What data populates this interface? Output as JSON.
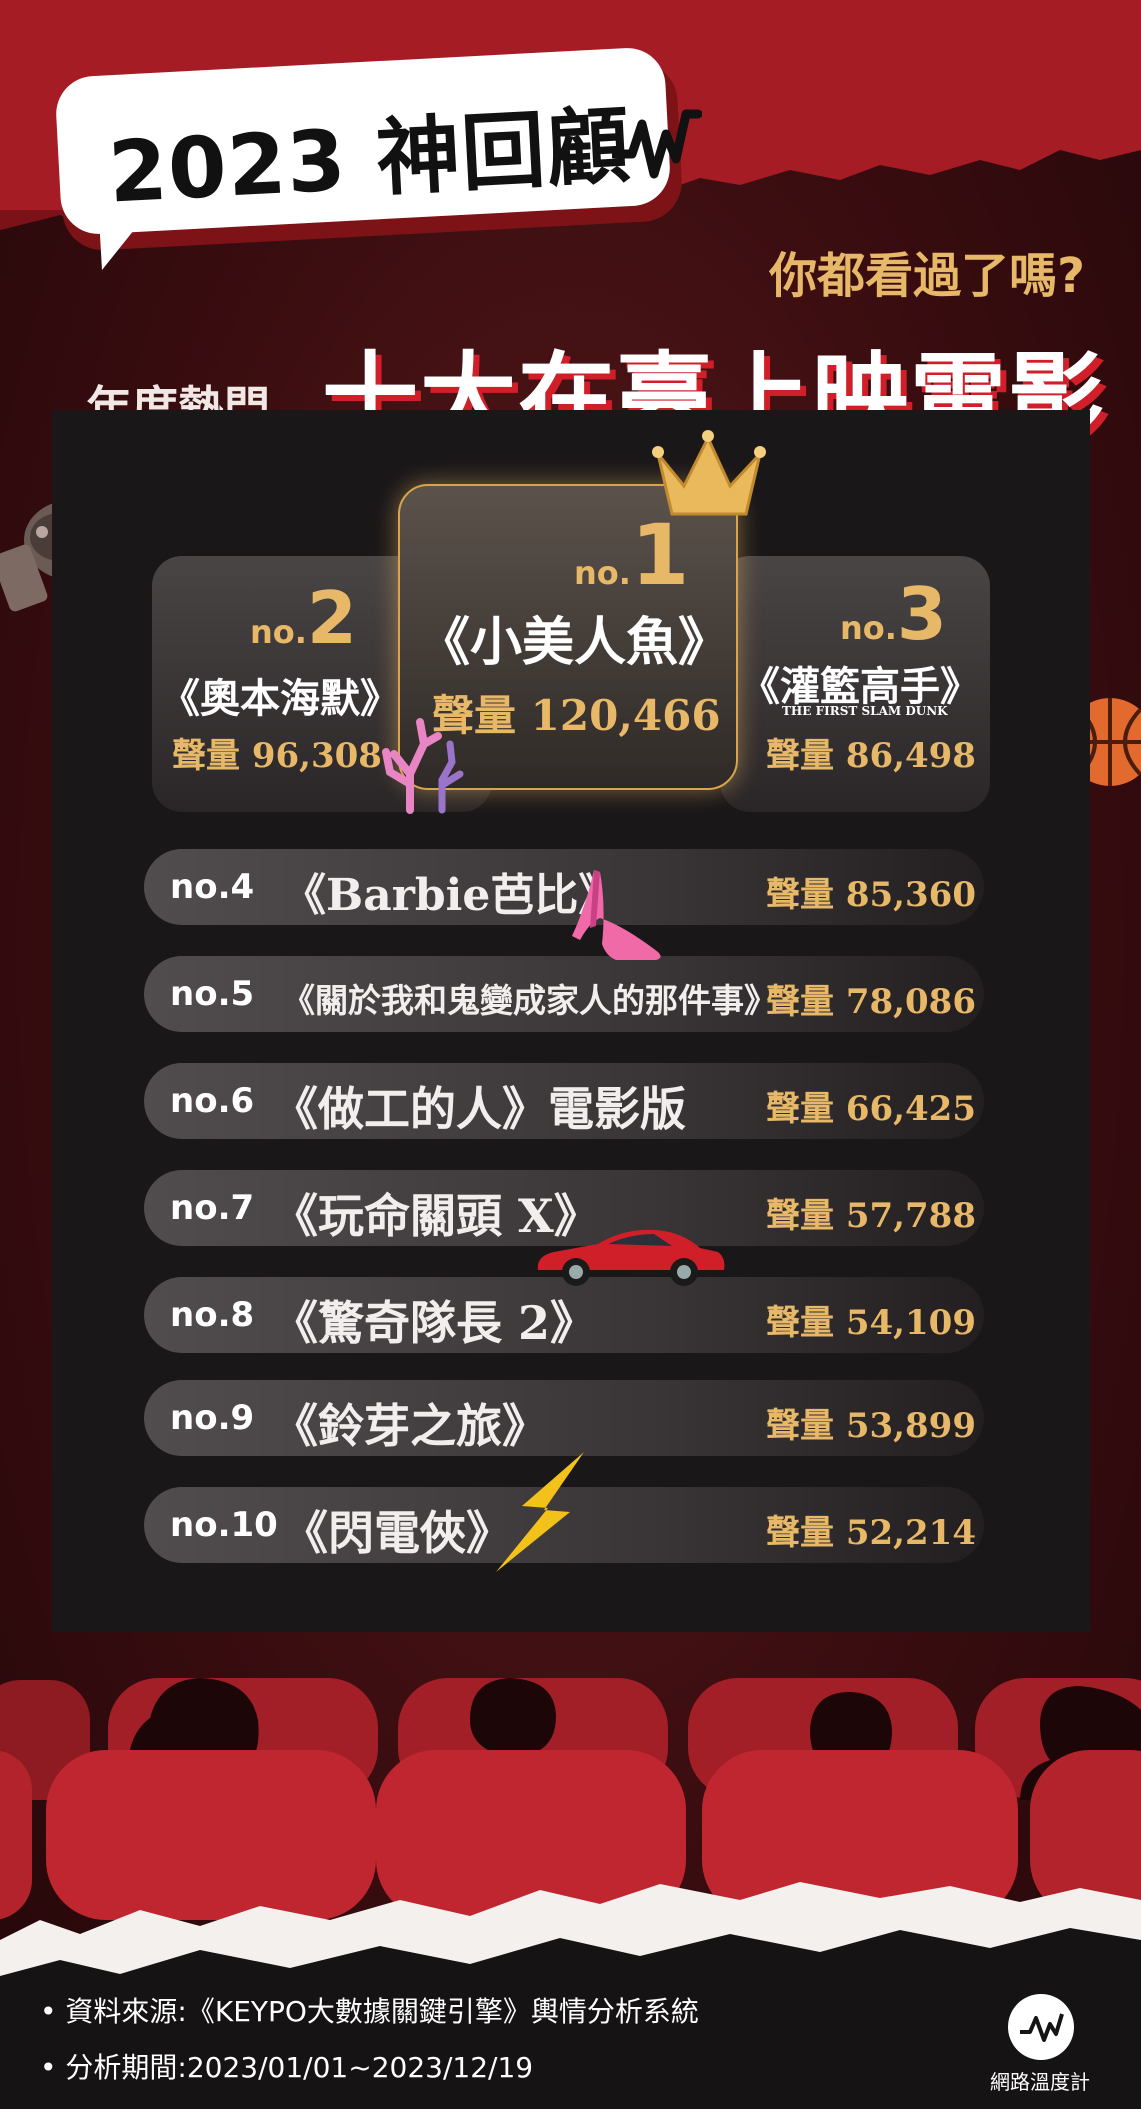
{
  "header": {
    "title": "2023 神回顧",
    "question": "你都看過了嗎?",
    "year_label": "年度熱門",
    "main_title": "十大在臺上映電影"
  },
  "top3": [
    {
      "rank_prefix": "no.",
      "rank": "1",
      "title": "《小美人魚》",
      "volume": "聲量 120,466"
    },
    {
      "rank_prefix": "no.",
      "rank": "2",
      "title": "《奧本海默》",
      "volume": "聲量 96,308"
    },
    {
      "rank_prefix": "no.",
      "rank": "3",
      "title": "《灌籃高手》",
      "subtitle": "THE FIRST SLAM DUNK",
      "volume": "聲量 86,498"
    }
  ],
  "list": [
    {
      "rank": "no.4",
      "title": "《Barbie芭比》",
      "volume": "聲量 85,360"
    },
    {
      "rank": "no.5",
      "title": "《關於我和鬼變成家人的那件事》",
      "volume": "聲量 78,086"
    },
    {
      "rank": "no.6",
      "title": "《做工的人》電影版",
      "volume": "聲量 66,425"
    },
    {
      "rank": "no.7",
      "title": "《玩命關頭 X》",
      "volume": "聲量 57,788"
    },
    {
      "rank": "no.8",
      "title": "《驚奇隊長 2》",
      "volume": "聲量 54,109"
    },
    {
      "rank": "no.9",
      "title": "《鈴芽之旅》",
      "volume": "聲量 53,899"
    },
    {
      "rank": "no.10",
      "title": "《閃電俠》",
      "volume": "聲量 52,214"
    }
  ],
  "footer": {
    "source": "• 資料來源:《KEYPO大數據關鍵引擎》輿情分析系統",
    "period": "• 分析期間:2023/01/01~2023/12/19",
    "brand": "網路溫度計"
  },
  "icons": [
    "crown-icon",
    "coral-icon",
    "basketball-icon",
    "high-heel-icon",
    "sports-car-icon",
    "lightning-icon",
    "film-camera-icon",
    "pulse-logo-icon"
  ],
  "colors": {
    "accent_gold": "#e8b869",
    "brand_red": "#c71f28",
    "screen": "#1a1719"
  }
}
